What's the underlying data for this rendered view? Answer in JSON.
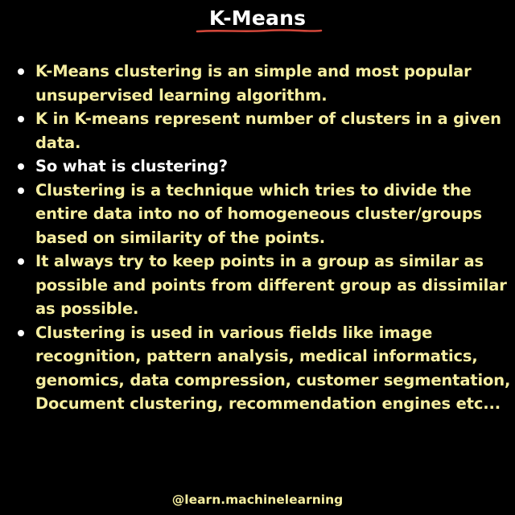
{
  "title": "K-Means",
  "colors": {
    "background": "#000000",
    "title": "#ffffff",
    "bullet_text": "#f6eea0",
    "bullet_text_white": "#ffffff",
    "bullet_dot": "#ffffff",
    "underline": "#d2473a",
    "footer": "#f6eea0"
  },
  "bullets": [
    {
      "text": "K-Means clustering is an simple and most popular unsupervised learning algorithm.",
      "color": "yellow"
    },
    {
      "text": "K in K-means represent number of clusters in a given data.",
      "color": "yellow"
    },
    {
      "text": "So what is clustering?",
      "color": "white"
    },
    {
      "text": "Clustering is a technique which tries to divide the entire data into no of homogeneous cluster/groups based on similarity of the points.",
      "color": "yellow"
    },
    {
      "text": "It always try to keep points in a group as similar as possible and points from different group as dissimilar as possible.",
      "color": "yellow"
    },
    {
      "text": "Clustering is used in various fields like image recognition, pattern analysis, medical informatics, genomics, data compression, customer segmentation, Document clustering, recommendation engines etc...",
      "color": "yellow"
    }
  ],
  "footer": "@learn.machinelearning"
}
